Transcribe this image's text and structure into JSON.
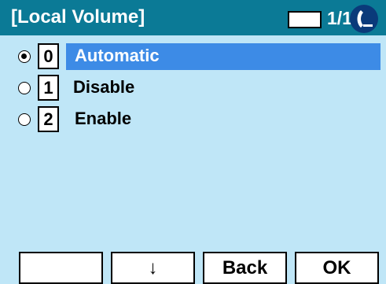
{
  "header": {
    "title": "[Local Volume]",
    "page_indicator": "1/1",
    "status_icon": "handset-icon"
  },
  "options": [
    {
      "key": "0",
      "label": "Automatic",
      "selected": true
    },
    {
      "key": "1",
      "label": "Disable",
      "selected": false
    },
    {
      "key": "2",
      "label": "Enable",
      "selected": false
    }
  ],
  "softkeys": [
    "",
    "↓",
    "Back",
    "OK"
  ],
  "colors": {
    "header": "#0b7a96",
    "background": "#bfe6f7",
    "highlight": "#3d8be6"
  }
}
